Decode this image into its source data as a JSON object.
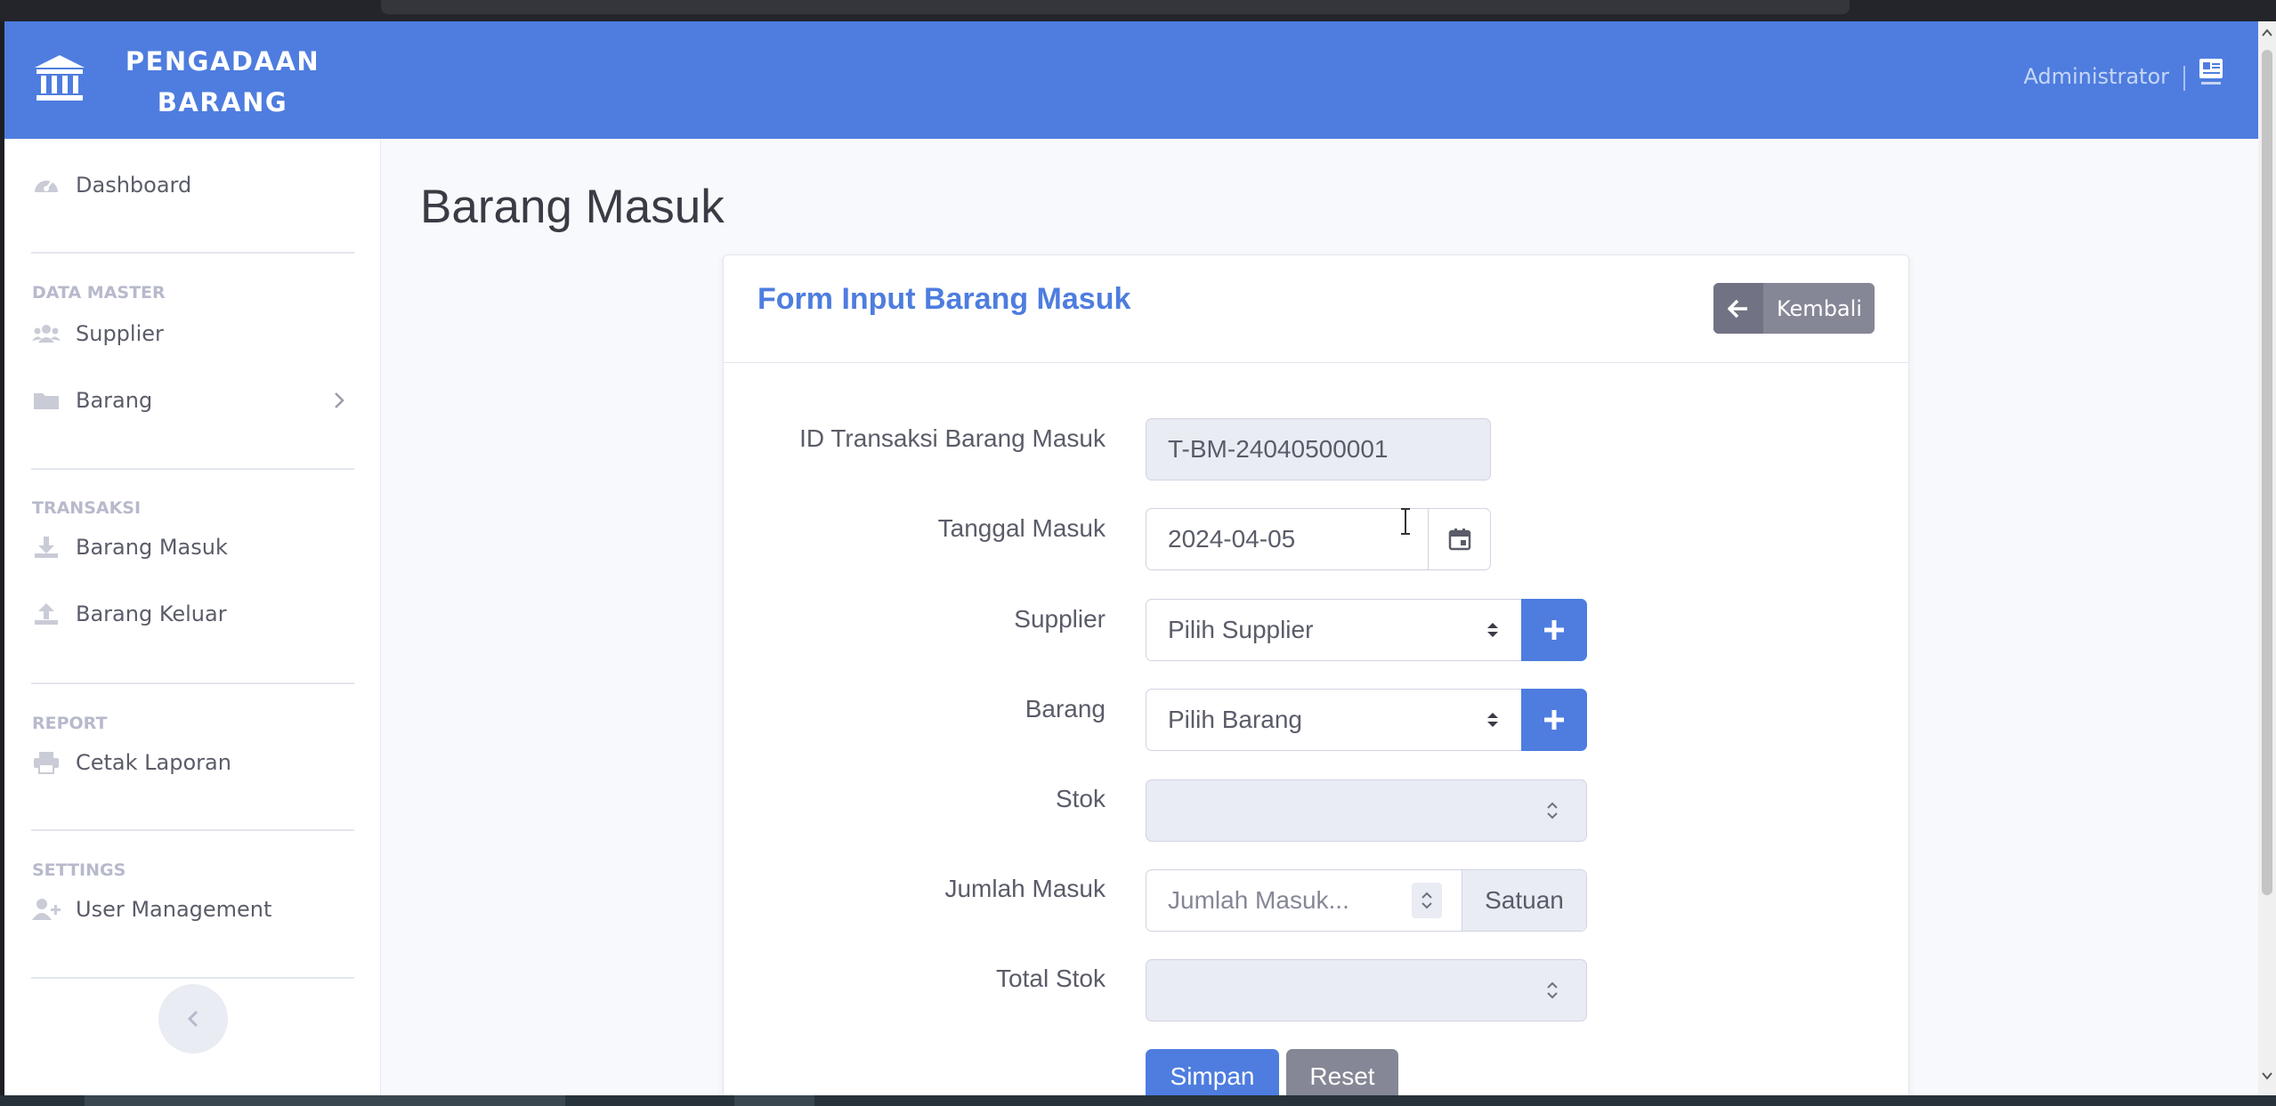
{
  "app": {
    "brand": [
      "PENGADAAN",
      "BARANG"
    ],
    "user": "Administrator"
  },
  "sidebar": {
    "dashboard": "Dashboard",
    "sections": {
      "master": "DATA MASTER",
      "transaksi": "TRANSAKSI",
      "report": "REPORT",
      "settings": "SETTINGS"
    },
    "items": {
      "supplier": "Supplier",
      "barang": "Barang",
      "barang_masuk": "Barang Masuk",
      "barang_keluar": "Barang Keluar",
      "cetak_laporan": "Cetak Laporan",
      "user_management": "User Management"
    }
  },
  "page": {
    "title": "Barang Masuk"
  },
  "form": {
    "title": "Form Input Barang Masuk",
    "back_label": "Kembali",
    "fields": {
      "id_label": "ID Transaksi Barang Masuk",
      "id_value": "T-BM-24040500001",
      "tanggal_label": "Tanggal Masuk",
      "tanggal_value": "2024-04-05",
      "supplier_label": "Supplier",
      "supplier_value": "Pilih Supplier",
      "barang_label": "Barang",
      "barang_value": "Pilih Barang",
      "stok_label": "Stok",
      "stok_value": "",
      "jumlah_label": "Jumlah Masuk",
      "jumlah_placeholder": "Jumlah Masuk...",
      "satuan": "Satuan",
      "total_label": "Total Stok",
      "total_value": ""
    },
    "buttons": {
      "save": "Simpan",
      "reset": "Reset"
    }
  },
  "colors": {
    "primary": "#4e7ddf",
    "secondary": "#858796",
    "text": "#5a5c69"
  }
}
